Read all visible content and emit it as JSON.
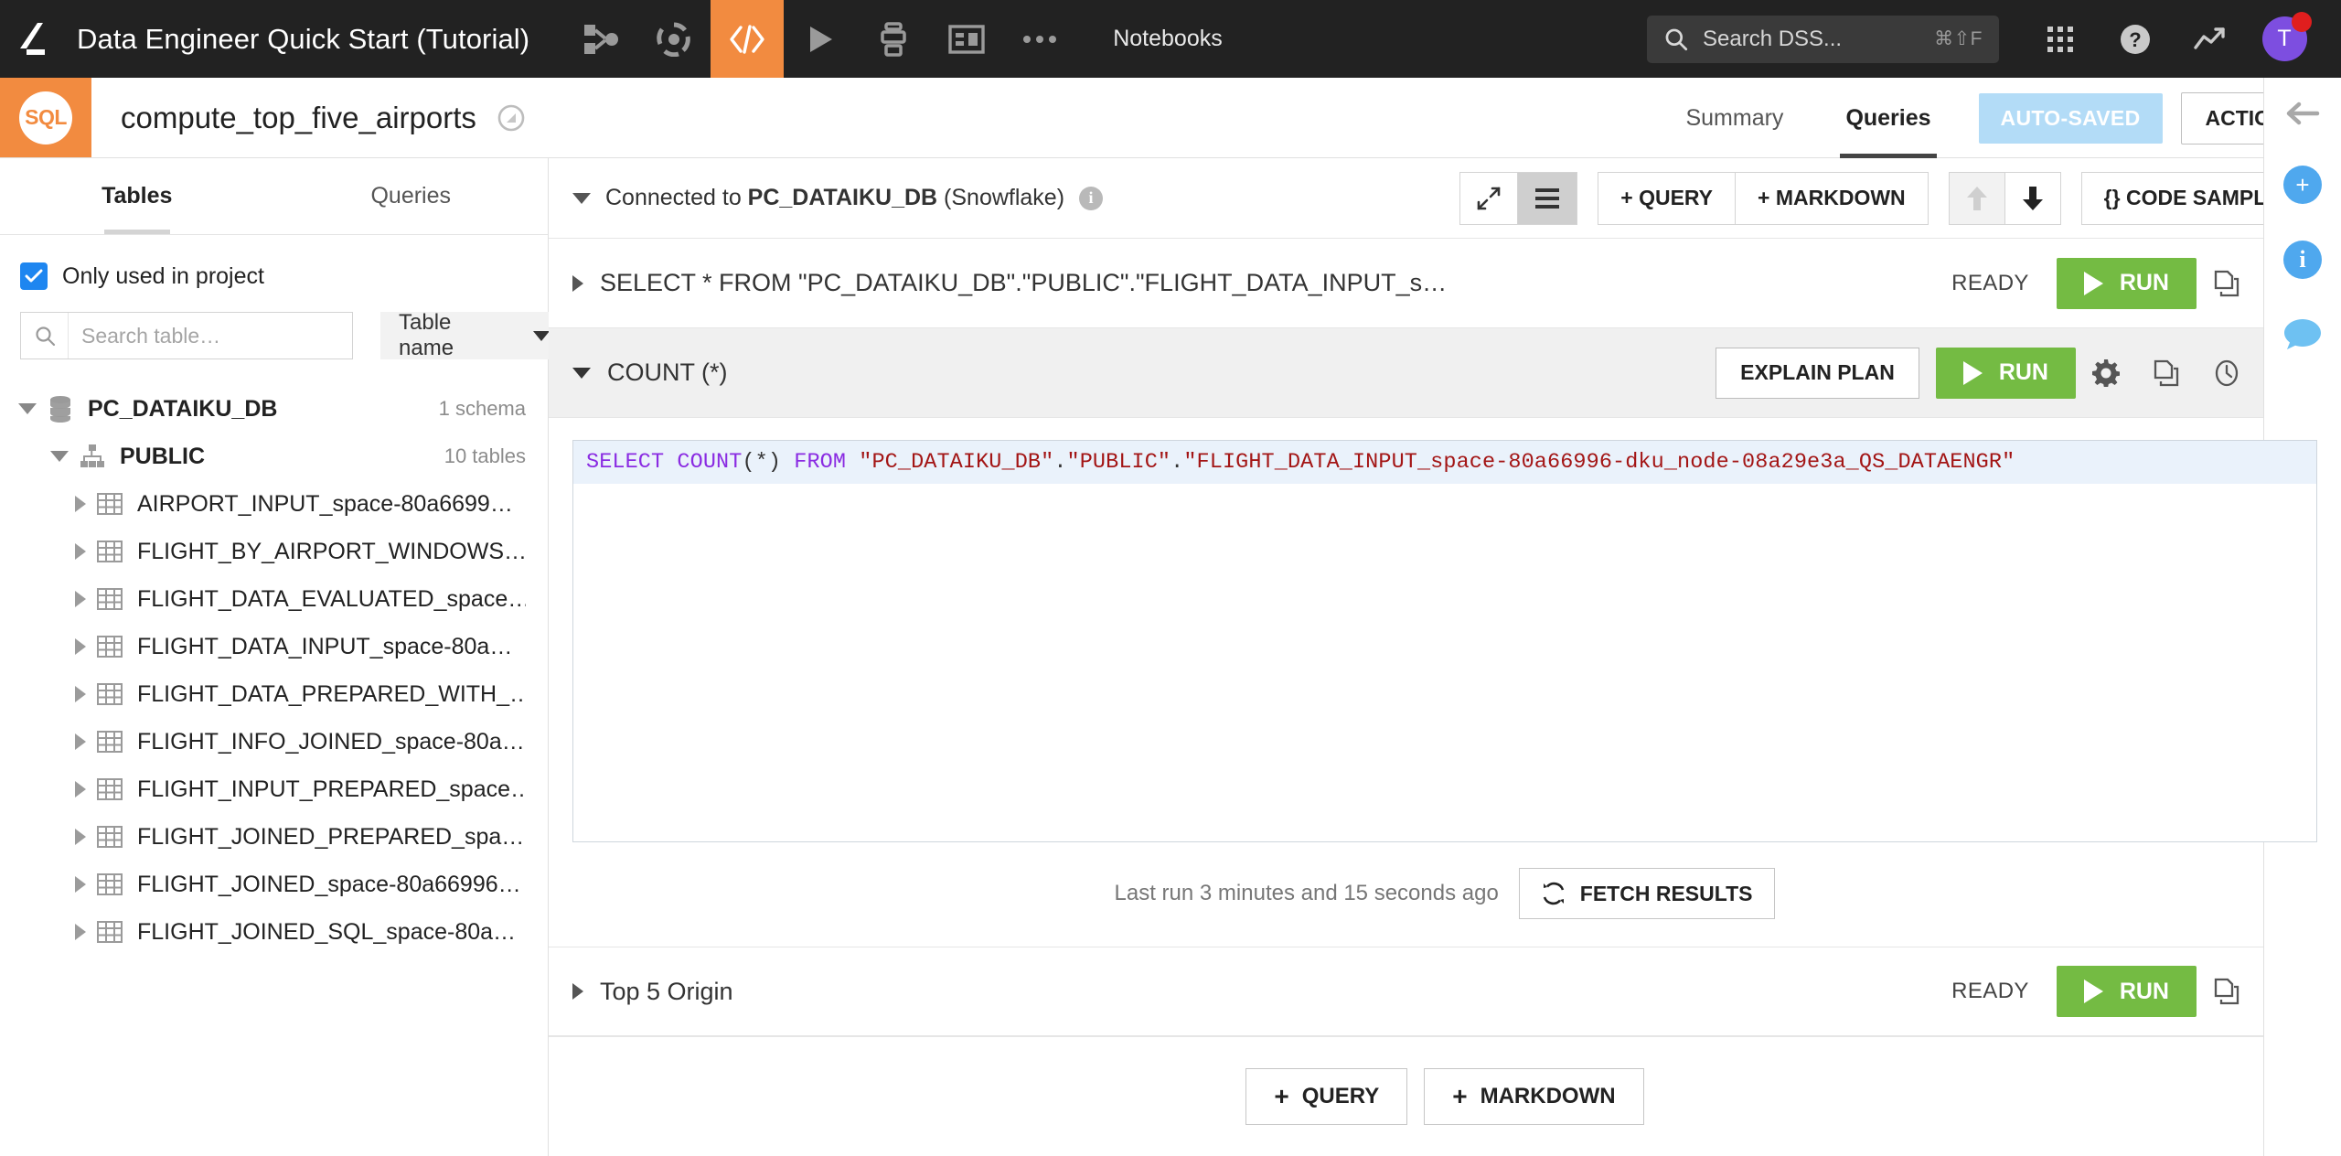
{
  "topnav": {
    "project_title": "Data Engineer Quick Start (Tutorial)",
    "section_label": "Notebooks",
    "icons": [
      {
        "name": "flow-icon",
        "label": "Flow"
      },
      {
        "name": "lab-icon",
        "label": "Lab"
      },
      {
        "name": "code-icon",
        "label": "Code",
        "active": true
      },
      {
        "name": "run-icon",
        "label": "Run"
      },
      {
        "name": "jobs-icon",
        "label": "Jobs"
      },
      {
        "name": "dashboard-icon",
        "label": "Dashboards"
      },
      {
        "name": "more-icon",
        "label": "More"
      }
    ],
    "search": {
      "placeholder": "Search DSS...",
      "shortcut": "⌘⇧F"
    },
    "avatar_initial": "T"
  },
  "subheader": {
    "badge_text": "SQL",
    "notebook_name": "compute_top_five_airports",
    "tabs": [
      {
        "label": "Summary",
        "active": false
      },
      {
        "label": "Queries",
        "active": true
      }
    ],
    "autosaved_label": "AUTO-SAVED",
    "actions_label": "ACTIONS"
  },
  "sidebar": {
    "tabs": [
      {
        "label": "Tables",
        "active": true
      },
      {
        "label": "Queries",
        "active": false
      }
    ],
    "only_used_label": "Only used in project",
    "only_used_checked": true,
    "search_placeholder": "Search table…",
    "search_value": "",
    "sort_label": "Table name",
    "database": {
      "name": "PC_DATAIKU_DB",
      "meta": "1 schema"
    },
    "schema": {
      "name": "PUBLIC",
      "meta": "10 tables"
    },
    "tables": [
      {
        "name": "AIRPORT_INPUT_space-80a6699…"
      },
      {
        "name": "FLIGHT_BY_AIRPORT_WINDOWS…"
      },
      {
        "name": "FLIGHT_DATA_EVALUATED_space…"
      },
      {
        "name": "FLIGHT_DATA_INPUT_space-80a…"
      },
      {
        "name": "FLIGHT_DATA_PREPARED_WITH_…"
      },
      {
        "name": "FLIGHT_INFO_JOINED_space-80a…"
      },
      {
        "name": "FLIGHT_INPUT_PREPARED_space…"
      },
      {
        "name": "FLIGHT_JOINED_PREPARED_spa…"
      },
      {
        "name": "FLIGHT_JOINED_space-80a66996…"
      },
      {
        "name": "FLIGHT_JOINED_SQL_space-80a…"
      }
    ]
  },
  "main": {
    "connection": {
      "prefix": "Connected to ",
      "db": "PC_DATAIKU_DB",
      "suffix": " (Snowflake)"
    },
    "toolbar": {
      "expand_label": "Expand",
      "list_label": "List view",
      "add_query_label": "+ QUERY",
      "add_markdown_label": "+ MARKDOWN",
      "move_up_label": "Move up",
      "move_down_label": "Move down",
      "code_samples_label": "{} CODE SAMPLES"
    },
    "cells": [
      {
        "title": "SELECT * FROM \"PC_DATAIKU_DB\".\"PUBLIC\".\"FLIGHT_DATA_INPUT_s…",
        "status": "READY",
        "run_label": "RUN",
        "expanded": false
      },
      {
        "title": "COUNT (*)",
        "status": "",
        "explain_label": "EXPLAIN PLAN",
        "run_label": "RUN",
        "expanded": true,
        "code": {
          "tokens": [
            {
              "t": "SELECT",
              "c": "kw"
            },
            {
              "t": " ",
              "c": "pl"
            },
            {
              "t": "COUNT",
              "c": "kw"
            },
            {
              "t": "(*)",
              "c": "pl"
            },
            {
              "t": " ",
              "c": "pl"
            },
            {
              "t": "FROM",
              "c": "kw"
            },
            {
              "t": " ",
              "c": "pl"
            },
            {
              "t": "\"PC_DATAIKU_DB\"",
              "c": "str"
            },
            {
              "t": ".",
              "c": "pl"
            },
            {
              "t": "\"PUBLIC\"",
              "c": "str"
            },
            {
              "t": ".",
              "c": "pl"
            },
            {
              "t": "\"FLIGHT_DATA_INPUT_space-80a66996-dku_node-08a29e3a_QS_DATAENGR\"",
              "c": "str"
            }
          ],
          "plain": "SELECT COUNT(*) FROM \"PC_DATAIKU_DB\".\"PUBLIC\".\"FLIGHT_DATA_INPUT_space-80a66996-dku_node-08a29e3a_QS_DATAENGR\""
        },
        "last_run": "Last run 3 minutes and 15 seconds ago",
        "fetch_label": "FETCH RESULTS"
      },
      {
        "title": "Top 5 Origin",
        "status": "READY",
        "run_label": "RUN",
        "expanded": false
      }
    ],
    "footer": {
      "add_query_label": "QUERY",
      "add_markdown_label": "MARKDOWN"
    }
  },
  "colors": {
    "brand_orange": "#f28b40",
    "run_green": "#74bb43",
    "autosave_blue": "#b3dcf7",
    "checkbox_blue": "#1e86f0",
    "avatar_purple": "#7d4ee0",
    "notification_red": "#e01e1e",
    "sql_keyword": "#8a2be2",
    "sql_string": "#a31515"
  }
}
